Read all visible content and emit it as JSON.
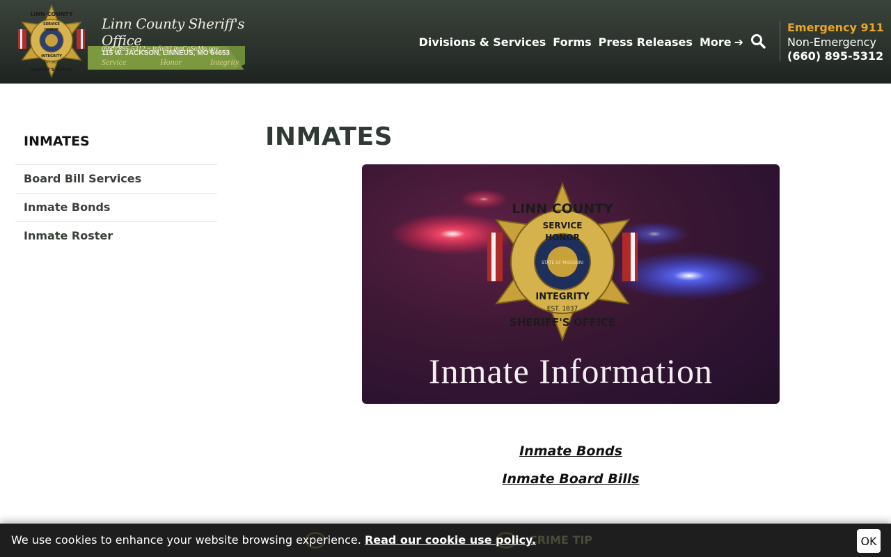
{
  "header": {
    "logo": {
      "title": "Linn County Sheriff's Office",
      "address": "115 W. JACKSON, LINNEUS, MO 64653",
      "phone": "(660) 895-5312",
      "email": "info@LinnCoSoMo.gov",
      "contact_separator": "~",
      "motto": [
        "Service",
        "Honor",
        "Integrity"
      ],
      "badge_text": {
        "top": "LINN COUNTY",
        "ribbon1": "SERVICE",
        "ribbon2": "HONOR",
        "ribbon3": "INTEGRITY",
        "est": "EST. 1837",
        "bottom": "SHERIFF'S OFFICE"
      }
    },
    "nav": [
      {
        "label": "Divisions & Services"
      },
      {
        "label": "Forms"
      },
      {
        "label": "Press Releases"
      },
      {
        "label": "More"
      }
    ],
    "search_icon": "search-icon",
    "more_icon": "arrow-right-icon",
    "contact": {
      "emergency": "Emergency 911",
      "non_emergency_label": "Non-Emergency",
      "non_emergency_number": "(660) 895-5312"
    }
  },
  "sidebar": {
    "title": "INMATES",
    "items": [
      {
        "label": "Board Bill Services"
      },
      {
        "label": "Inmate Bonds"
      },
      {
        "label": "Inmate Roster"
      }
    ]
  },
  "main": {
    "title": "INMATES",
    "hero": {
      "badge_top": "LINN COUNTY",
      "badge_ribbon1": "SERVICE",
      "badge_ribbon2": "HONOR",
      "badge_center": "STATE OF MISSOURI",
      "badge_ribbon3": "INTEGRITY",
      "badge_est": "EST. 1837",
      "badge_bottom": "SHERIFF'S OFFICE",
      "caption": "Inmate Information"
    },
    "links": [
      {
        "label": "Inmate Bonds"
      },
      {
        "label": "Inmate Board Bills"
      }
    ]
  },
  "cookie_bar": {
    "text": "We use cookies to enhance your website browsing experience.",
    "link": "Read our cookie use policy.",
    "ok": "OK",
    "behind_text": "CRIME TIP"
  },
  "colors": {
    "header_bg": "#2c332d",
    "accent_gold": "#e8a629",
    "hero_bg": "#3d1834"
  }
}
